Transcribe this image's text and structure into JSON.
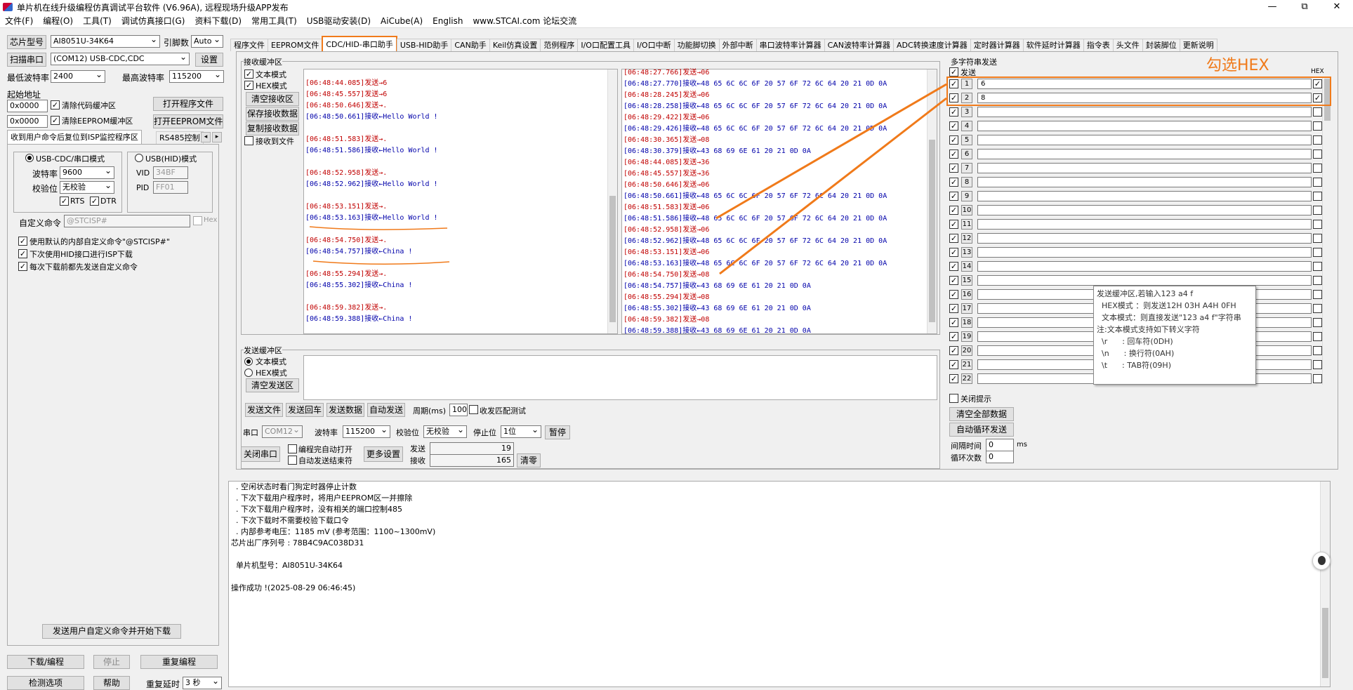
{
  "window": {
    "title": "单片机在线升级编程仿真调试平台软件 (V6.96A), 远程现场升级APP发布",
    "btn_min": "—",
    "btn_max": "⧉",
    "btn_close": "✕"
  },
  "menu": [
    "文件(F)",
    "编程(O)",
    "工具(T)",
    "调试仿真接口(G)",
    "资料下载(D)",
    "常用工具(T)",
    "USB驱动安装(D)",
    "AiCube(A)",
    "English",
    "www.STCAI.com 论坛交流"
  ],
  "left": {
    "chip_label": "芯片型号",
    "chip_value": "AI8051U-34K64",
    "pin_label": "引脚数",
    "pin_value": "Auto",
    "scan_button": "扫描串口",
    "port_value": "(COM12) USB-CDC,CDC",
    "settings_button": "设置",
    "min_baud_label": "最低波特率",
    "min_baud_value": "2400",
    "max_baud_label": "最高波特率",
    "max_baud_value": "115200",
    "start_addr_label": "起始地址",
    "addr1": "0x0000",
    "clear_code_label": "清除代码缓冲区",
    "open_prog_button": "打开程序文件",
    "addr2": "0x0000",
    "clear_eeprom_label": "清除EEPROM缓冲区",
    "open_eeprom_button": "打开EEPROM文件",
    "tab1": "收到用户命令后复位到ISP监控程序区",
    "tab2": "RS485控制",
    "tab_prev": "◂",
    "tab_next": "▸",
    "usb_cdc_mode": "USB-CDC/串口模式",
    "usb_hid_mode": "USB(HID)模式",
    "baud_label": "波特率",
    "baud_value": "9600",
    "parity_label": "校验位",
    "parity_value": "无校验",
    "rts": "RTS",
    "dtr": "DTR",
    "vid_label": "VID",
    "vid_value": "34BF",
    "pid_label": "PID",
    "pid_value": "FF01",
    "custom_cmd_label": "自定义命令",
    "custom_cmd_value": "@STCISP#",
    "hex_label": "Hex",
    "opt1": "使用默认的内部自定义命令\"@STCISP#\"",
    "opt2": "下次使用HID接口进行ISP下载",
    "opt3": "每次下载前都先发送自定义命令",
    "send_custom_button": "发送用户自定义命令并开始下载",
    "download_button": "下载/编程",
    "stop_button": "停止",
    "redownload_button": "重复编程",
    "check_button": "检测选项",
    "help_button": "帮助",
    "repeat_delay_label": "重复延时",
    "repeat_delay_value": "3 秒"
  },
  "tabs": [
    "程序文件",
    "EEPROM文件",
    "CDC/HID-串口助手",
    "USB-HID助手",
    "CAN助手",
    "Keil仿真设置",
    "范例程序",
    "I/O口配置工具",
    "I/O口中断",
    "功能脚切换",
    "外部中断",
    "串口波特率计算器",
    "CAN波特率计算器",
    "ADC转换速度计算器",
    "定时器计算器",
    "软件延时计算器",
    "指令表",
    "头文件",
    "封装脚位",
    "更新说明"
  ],
  "receive": {
    "group_label": "接收缓冲区",
    "text_mode": "文本模式",
    "hex_mode": "HEX模式",
    "clear_button": "清空接收区",
    "save_button": "保存接收数据",
    "copy_button": "复制接收数据",
    "to_file": "接收到文件",
    "left_log": [
      {
        "t": "[06:48:44.085]发送→6",
        "c": "s"
      },
      {
        "t": "[06:48:45.557]发送→6",
        "c": "s"
      },
      {
        "t": "[06:48:50.646]发送→.",
        "c": "s"
      },
      {
        "t": "[06:48:50.661]接收←Hello World !",
        "c": "r"
      },
      {
        "t": "",
        "c": "r"
      },
      {
        "t": "[06:48:51.583]发送→.",
        "c": "s"
      },
      {
        "t": "[06:48:51.586]接收←Hello World !",
        "c": "r"
      },
      {
        "t": "",
        "c": "r"
      },
      {
        "t": "[06:48:52.958]发送→.",
        "c": "s"
      },
      {
        "t": "[06:48:52.962]接收←Hello World !",
        "c": "r"
      },
      {
        "t": "",
        "c": "r"
      },
      {
        "t": "[06:48:53.151]发送→.",
        "c": "s"
      },
      {
        "t": "[06:48:53.163]接收←Hello World !",
        "c": "r"
      },
      {
        "t": "",
        "c": "r"
      },
      {
        "t": "[06:48:54.750]发送→.",
        "c": "s"
      },
      {
        "t": "[06:48:54.757]接收←China !",
        "c": "r"
      },
      {
        "t": "",
        "c": "r"
      },
      {
        "t": "[06:48:55.294]发送→.",
        "c": "s"
      },
      {
        "t": "[06:48:55.302]接收←China !",
        "c": "r"
      },
      {
        "t": "",
        "c": "r"
      },
      {
        "t": "[06:48:59.382]发送→.",
        "c": "s"
      },
      {
        "t": "[06:48:59.388]接收←China !",
        "c": "r"
      }
    ],
    "right_log": [
      {
        "t": "[06:48:27.766]发送→06",
        "c": "s"
      },
      {
        "t": "[06:48:27.770]接收←48 65 6C 6C 6F 20 57 6F 72 6C 64 20 21 0D 0A",
        "c": "r"
      },
      {
        "t": "[06:48:28.245]发送→06",
        "c": "s"
      },
      {
        "t": "[06:48:28.258]接收←48 65 6C 6C 6F 20 57 6F 72 6C 64 20 21 0D 0A",
        "c": "r"
      },
      {
        "t": "[06:48:29.422]发送→06",
        "c": "s"
      },
      {
        "t": "[06:48:29.426]接收←48 65 6C 6C 6F 20 57 6F 72 6C 64 20 21 0D 0A",
        "c": "r"
      },
      {
        "t": "[06:48:30.365]发送→08",
        "c": "s"
      },
      {
        "t": "[06:48:30.379]接收←43 68 69 6E 61 20 21 0D 0A",
        "c": "r"
      },
      {
        "t": "[06:48:44.085]发送→36",
        "c": "s"
      },
      {
        "t": "[06:48:45.557]发送→36",
        "c": "s"
      },
      {
        "t": "[06:48:50.646]发送→06",
        "c": "s"
      },
      {
        "t": "[06:48:50.661]接收←48 65 6C 6C 6F 20 57 6F 72 6C 64 20 21 0D 0A",
        "c": "r"
      },
      {
        "t": "[06:48:51.583]发送→06",
        "c": "s"
      },
      {
        "t": "[06:48:51.586]接收←48 65 6C 6C 6F 20 57 6F 72 6C 64 20 21 0D 0A",
        "c": "r"
      },
      {
        "t": "[06:48:52.958]发送→06",
        "c": "s"
      },
      {
        "t": "[06:48:52.962]接收←48 65 6C 6C 6F 20 57 6F 72 6C 64 20 21 0D 0A",
        "c": "r"
      },
      {
        "t": "[06:48:53.151]发送→06",
        "c": "s"
      },
      {
        "t": "[06:48:53.163]接收←48 65 6C 6C 6F 20 57 6F 72 6C 64 20 21 0D 0A",
        "c": "r"
      },
      {
        "t": "[06:48:54.750]发送→08",
        "c": "s"
      },
      {
        "t": "[06:48:54.757]接收←43 68 69 6E 61 20 21 0D 0A",
        "c": "r"
      },
      {
        "t": "[06:48:55.294]发送→08",
        "c": "s"
      },
      {
        "t": "[06:48:55.302]接收←43 68 69 6E 61 20 21 0D 0A",
        "c": "r"
      },
      {
        "t": "[06:48:59.382]发送→08",
        "c": "s"
      },
      {
        "t": "[06:48:59.388]接收←43 68 69 6E 61 20 21 0D 0A",
        "c": "r"
      }
    ]
  },
  "send": {
    "group_label": "发送缓冲区",
    "text_mode": "文本模式",
    "hex_mode": "HEX模式",
    "clear_button": "清空发送区",
    "send_file": "发送文件",
    "send_cr": "发送回车",
    "send_data": "发送数据",
    "auto_send": "自动发送",
    "period_label": "周期(ms)",
    "period_value": "100",
    "match_test": "收发匹配测试",
    "port_label": "串口",
    "port_value": "COM12",
    "baud_label": "波特率",
    "baud_value": "115200",
    "parity_label": "校验位",
    "parity_value": "无校验",
    "stop_label": "停止位",
    "stop_value": "1位",
    "pause_button": "暂停",
    "close_port": "关闭串口",
    "auto_open": "编程完自动打开",
    "auto_end": "自动发送结束符",
    "more_settings": "更多设置",
    "sent_label": "发送",
    "sent_value": "19",
    "recv_label": "接收",
    "recv_value": "165",
    "clear_count": "清零"
  },
  "multi": {
    "group_label": "多字符串发送",
    "send_col": "发送",
    "hex_col": "HEX",
    "annotation": "勾选HEX",
    "rows": [
      {
        "n": "1",
        "v": "6",
        "hex": true
      },
      {
        "n": "2",
        "v": "8",
        "hex": true
      },
      {
        "n": "3",
        "v": "",
        "hex": false
      },
      {
        "n": "4",
        "v": "",
        "hex": false
      },
      {
        "n": "5",
        "v": "",
        "hex": false
      },
      {
        "n": "6",
        "v": "",
        "hex": false
      },
      {
        "n": "7",
        "v": "",
        "hex": false
      },
      {
        "n": "8",
        "v": "",
        "hex": false
      },
      {
        "n": "9",
        "v": "",
        "hex": false
      },
      {
        "n": "10",
        "v": "",
        "hex": false
      },
      {
        "n": "11",
        "v": "",
        "hex": false
      },
      {
        "n": "12",
        "v": "",
        "hex": false
      },
      {
        "n": "13",
        "v": "",
        "hex": false
      },
      {
        "n": "14",
        "v": "",
        "hex": false
      },
      {
        "n": "15",
        "v": "",
        "hex": false
      },
      {
        "n": "16",
        "v": "",
        "hex": false
      },
      {
        "n": "17",
        "v": "",
        "hex": false
      },
      {
        "n": "18",
        "v": "",
        "hex": false
      },
      {
        "n": "19",
        "v": "",
        "hex": false
      },
      {
        "n": "20",
        "v": "",
        "hex": false
      },
      {
        "n": "21",
        "v": "",
        "hex": false
      },
      {
        "n": "22",
        "v": "",
        "hex": false
      }
    ],
    "close_hint": "关闭提示",
    "clear_all": "清空全部数据",
    "auto_loop": "自动循环发送",
    "interval_label": "间隔时间",
    "interval_value": "0",
    "interval_unit": "ms",
    "loop_label": "循环次数",
    "loop_value": "0",
    "tooltip": "发送缓冲区,若输入123 a4 f\n  HEX模式 ：则发送12H 03H A4H 0FH\n  文本模式：则直接发送\"123 a4 f\"字符串\n注:文本模式支持如下转义字符\n  \\r      : 回车符(0DH)\n  \\n      : 换行符(0AH)\n  \\t      : TAB符(09H)"
  },
  "status_log": "  . 空闲状态时看门狗定时器停止计数\n  . 下次下载用户程序时，将用户EEPROM区一并擦除\n  . 下次下载用户程序时，没有相关的端口控制485\n  . 下次下载时不需要校验下载口令\n  . 内部参考电压：1185 mV (参考范围：1100~1300mV)\n芯片出厂序列号 : 78B4C9AC038D31\n\n  单片机型号：AI8051U-34K64\n\n操作成功 !(2025-08-29 06:46:45)",
  "colors": {
    "accent": "#f07a1a",
    "send_text": "#c00000",
    "recv_text": "#0000aa"
  }
}
